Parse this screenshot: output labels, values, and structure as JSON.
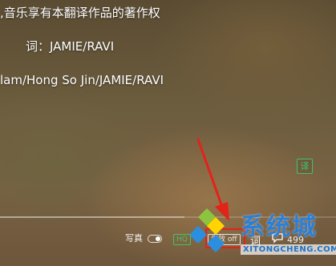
{
  "lyrics": {
    "line1": ",音乐享有本翻译作品的著作权",
    "line2": "词：JAMIE/RAVI",
    "line3": "lam/Hong So Jin/JAMIE/RAVI"
  },
  "controls": {
    "translate_label": "译",
    "xiezhen_label": "写真",
    "xiezhen_toggle": "on",
    "hq_label": "HQ",
    "sound_label": "音效 off",
    "lyric_label": "词",
    "comment_count": "499"
  },
  "progress": {
    "fraction": 0.55
  },
  "watermark": {
    "brand": "系统城",
    "site": "XITONGCHENG.COM"
  },
  "colors": {
    "accent_green": "#3fc56b",
    "annotation_red": "#e3221a",
    "watermark_blue": "#2b7fd6"
  }
}
